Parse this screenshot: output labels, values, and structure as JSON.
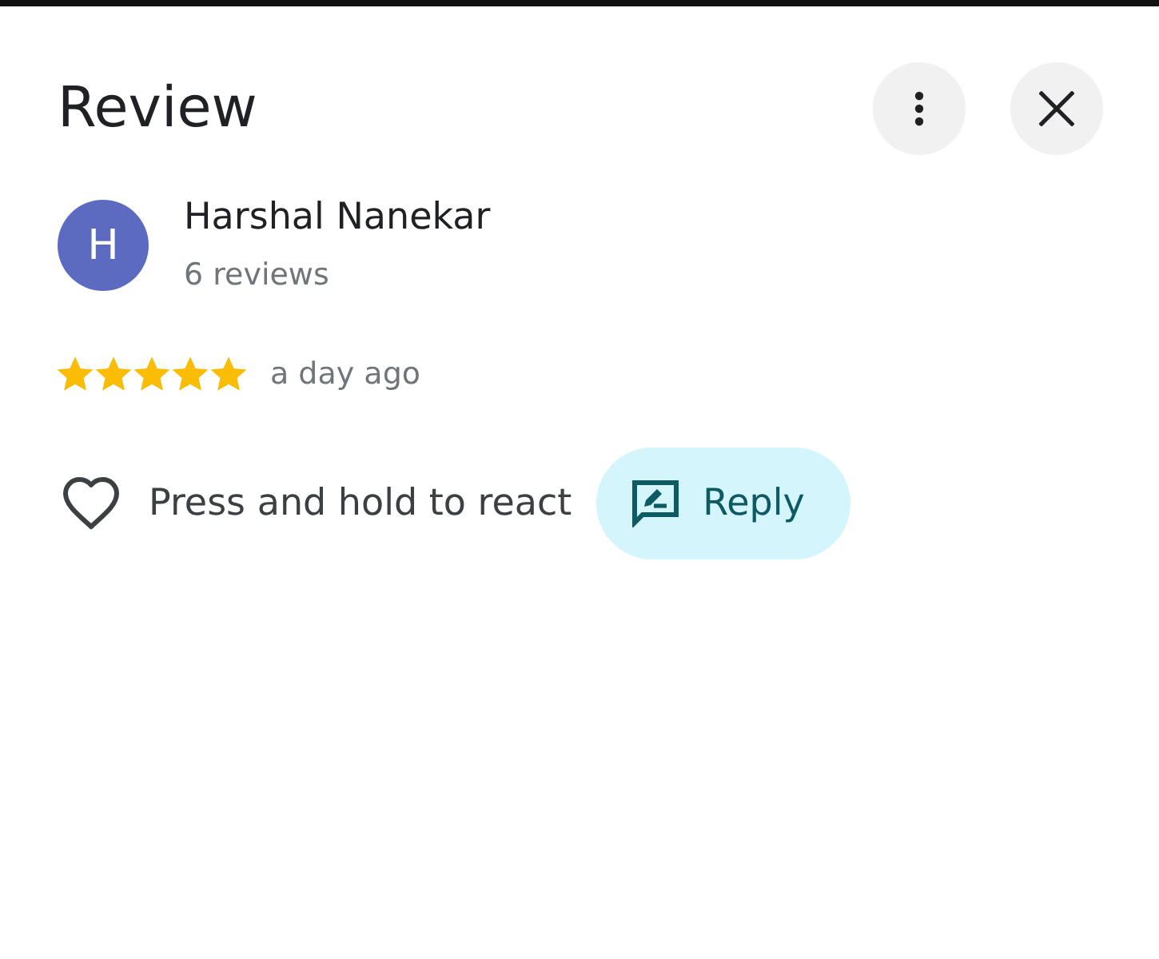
{
  "header": {
    "title": "Review"
  },
  "reviewer": {
    "initial": "H",
    "name": "Harshal Nanekar",
    "review_count": "6 reviews"
  },
  "rating": {
    "stars": 5,
    "time": "a day ago"
  },
  "actions": {
    "react_hint": "Press and hold to react",
    "reply_label": "Reply"
  }
}
